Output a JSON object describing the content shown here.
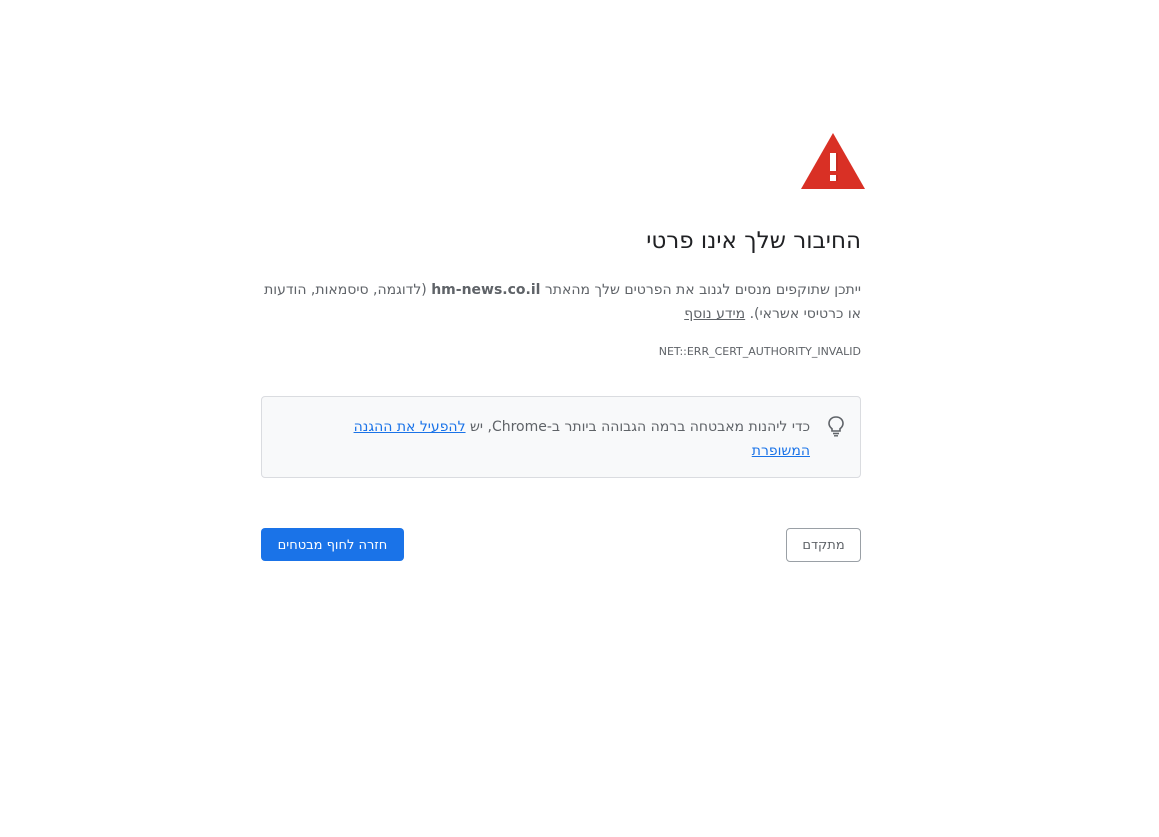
{
  "title": "החיבור שלך אינו פרטי",
  "description": {
    "part1": "ייתכן שתוקפים מנסים לגנוב את הפרטים שלך מהאתר ",
    "host": "hm-news.co.il",
    "part2": " (לדוגמה, סיסמאות, הודעות או כרטיסי אשראי). ",
    "learn_more": "מידע נוסף"
  },
  "error_code": "NET::ERR_CERT_AUTHORITY_INVALID",
  "enhanced_protection": {
    "text": "כדי ליהנות מאבטחה ברמה הגבוהה ביותר ב-Chrome, יש ",
    "link": "להפעיל את ההגנה המשופרת"
  },
  "buttons": {
    "back_to_safety": "חזרה לחוף מבטחים",
    "advanced": "מתקדם"
  },
  "colors": {
    "warning_red": "#d93025",
    "primary_blue": "#1a73e8",
    "text_gray": "#5f6368"
  },
  "icons": {
    "warning": "warning-triangle-icon",
    "tip": "lightbulb-icon"
  }
}
